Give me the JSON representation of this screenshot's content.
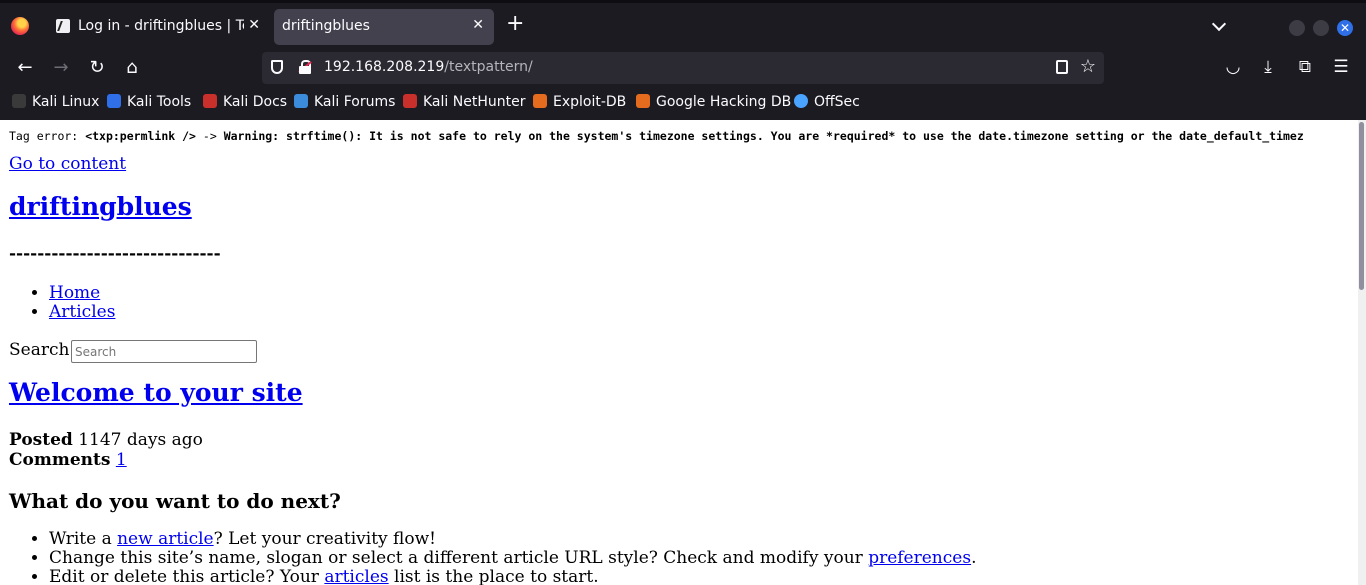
{
  "browser": {
    "tabs": [
      {
        "title": "Log in - driftingblues | Tex",
        "active": false
      },
      {
        "title": "driftingblues",
        "active": true
      }
    ],
    "url_host": "192.168.208.219",
    "url_path": "/textpattern/",
    "bookmarks": [
      {
        "label": "Kali Linux",
        "color": "#3a3a3a"
      },
      {
        "label": "Kali Tools",
        "color": "#2f6fe8"
      },
      {
        "label": "Kali Docs",
        "color": "#c9302c"
      },
      {
        "label": "Kali Forums",
        "color": "#3b8ddb"
      },
      {
        "label": "Kali NetHunter",
        "color": "#c9302c"
      },
      {
        "label": "Exploit-DB",
        "color": "#e56b1f"
      },
      {
        "label": "Google Hacking DB",
        "color": "#e56b1f"
      },
      {
        "label": "OffSec",
        "color": "#4aa3ff"
      }
    ],
    "icons": {
      "back": "arrow-left-icon",
      "forward": "arrow-right-icon",
      "reload": "reload-icon",
      "home": "home-icon",
      "pocket": "pocket-icon",
      "downloads": "download-icon",
      "extensions": "puzzle-icon",
      "menu": "hamburger-menu-icon"
    },
    "accent_color": "#2f6fe8"
  },
  "page": {
    "tag_error_prefix": "Tag error:",
    "tag_error_tag": "<txp:permlink />",
    "tag_error_arrow": "->",
    "tag_error_warning": "Warning: strftime(): It is not safe to rely on the system's timezone settings. You are *required* to use the date.timezone setting or the date_default_timez",
    "go_to_content": "Go to content",
    "site_name": "driftingblues",
    "dashes": "------------------------------",
    "nav_items": [
      "Home",
      "Articles"
    ],
    "search_label": "Search",
    "search_placeholder": "Search",
    "article_title": "Welcome to your site",
    "posted_label": "Posted",
    "posted_value": "1147 days ago",
    "comments_label": "Comments",
    "comments_count": "1",
    "next_heading": "What do you want to do next?",
    "next_items": [
      {
        "before": "Write a ",
        "link": "new article",
        "after": "? Let your creativity flow!"
      },
      {
        "before": "Change this site’s name, slogan or select a different article URL style? Check and modify your ",
        "link": "preferences",
        "after": "."
      },
      {
        "before": "Edit or delete this article? Your ",
        "link": "articles",
        "after": " list is the place to start."
      }
    ]
  }
}
